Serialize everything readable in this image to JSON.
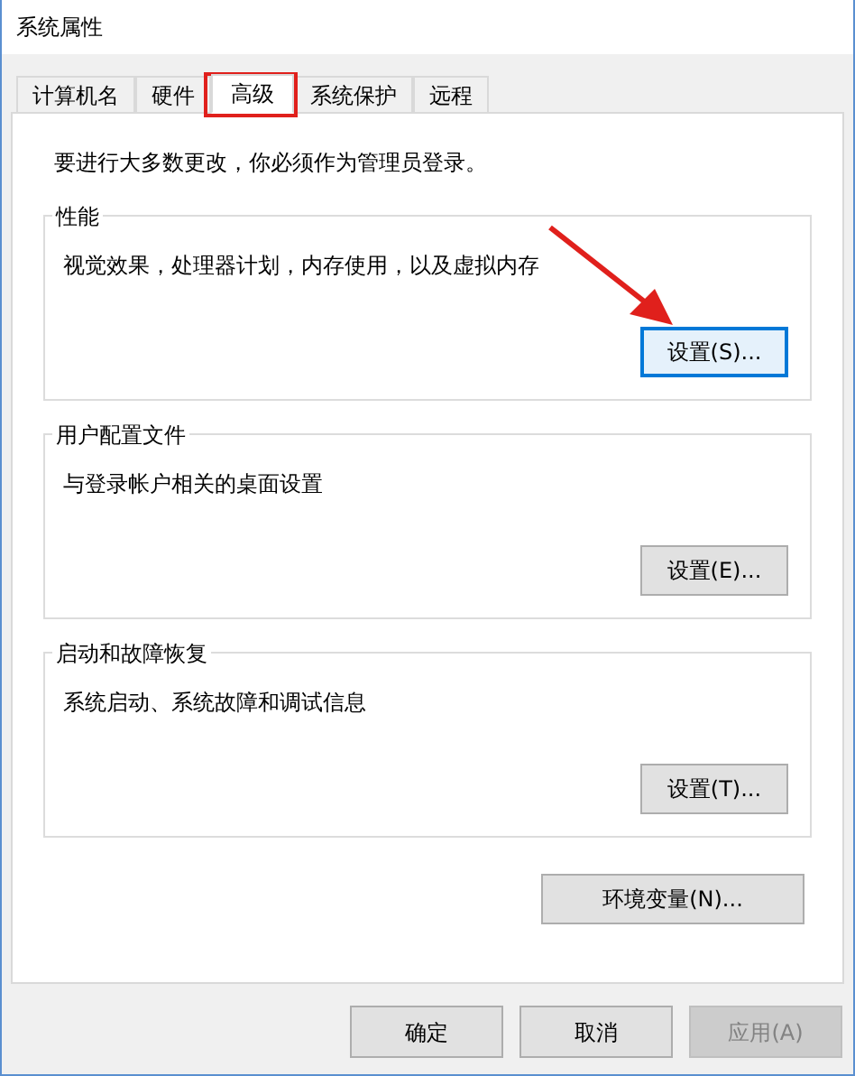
{
  "window": {
    "title": "系统属性"
  },
  "tabs": [
    {
      "label": "计算机名",
      "selected": false
    },
    {
      "label": "硬件",
      "selected": false
    },
    {
      "label": "高级",
      "selected": true
    },
    {
      "label": "系统保护",
      "selected": false
    },
    {
      "label": "远程",
      "selected": false
    }
  ],
  "notice": "要进行大多数更改，你必须作为管理员登录。",
  "groups": [
    {
      "title": "性能",
      "description": "视觉效果，处理器计划，内存使用，以及虚拟内存",
      "button": {
        "label": "设置(S)...",
        "focused": true
      }
    },
    {
      "title": "用户配置文件",
      "description": "与登录帐户相关的桌面设置",
      "button": {
        "label": "设置(E)...",
        "focused": false
      }
    },
    {
      "title": "启动和故障恢复",
      "description": "系统启动、系统故障和调试信息",
      "button": {
        "label": "设置(T)...",
        "focused": false
      }
    }
  ],
  "environment_button": "环境变量(N)...",
  "buttons": [
    {
      "label": "确定",
      "disabled": false
    },
    {
      "label": "取消",
      "disabled": false
    },
    {
      "label": "应用(A)",
      "disabled": true
    }
  ]
}
